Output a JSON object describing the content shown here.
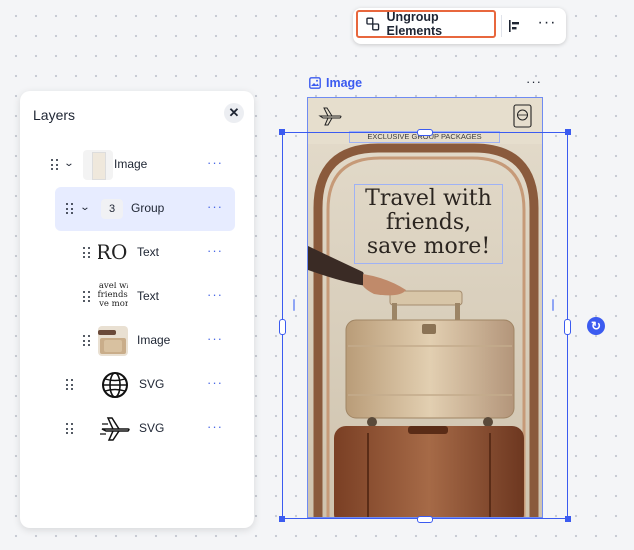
{
  "toolbar": {
    "ungroup_label": "Ungroup Elements",
    "more_label": "···"
  },
  "layers": {
    "title": "Layers",
    "close_label": "✕",
    "items": [
      {
        "label": "Image",
        "type": "image",
        "expanded": true,
        "more": "···"
      },
      {
        "label": "Group",
        "count": "3",
        "expanded": true,
        "selected": true,
        "more": "···"
      },
      {
        "label": "Text",
        "thumb_text": "ROU",
        "more": "···"
      },
      {
        "label": "Text",
        "thumb_text": "avel wi friends, ve mor",
        "more": "···"
      },
      {
        "label": "Image",
        "more": "···"
      },
      {
        "label": "SVG",
        "icon": "globe-icon",
        "more": "···"
      },
      {
        "label": "SVG",
        "icon": "airplane-icon",
        "more": "···"
      }
    ]
  },
  "canvas": {
    "selected_label": "Image",
    "more_label": "···",
    "banner_text": "EXCLUSIVE GROUP PACKAGES",
    "headline": "Travel with\nfriends,\nsave more!"
  },
  "colors": {
    "accent": "#3b5bf0",
    "highlight_border": "#e8673d",
    "selected_row": "#e7ecff",
    "poster_bg": "#dfd5c4"
  }
}
